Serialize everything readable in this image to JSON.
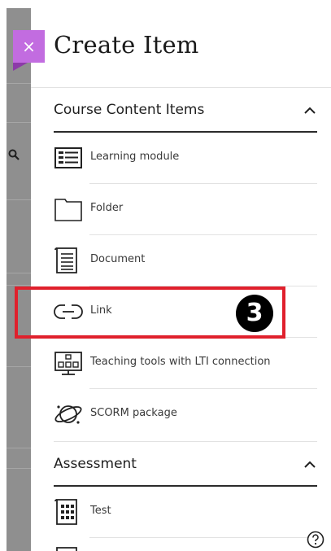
{
  "panel": {
    "title": "Create Item",
    "close_glyph": "×"
  },
  "sections": [
    {
      "label": "Course Content Items",
      "items": [
        {
          "label": "Learning module",
          "icon": "learning-module-icon"
        },
        {
          "label": "Folder",
          "icon": "folder-icon"
        },
        {
          "label": "Document",
          "icon": "document-icon"
        },
        {
          "label": "Link",
          "icon": "link-icon"
        },
        {
          "label": "Teaching tools with LTI connection",
          "icon": "lti-tools-icon"
        },
        {
          "label": "SCORM package",
          "icon": "scorm-package-icon"
        }
      ]
    },
    {
      "label": "Assessment",
      "items": [
        {
          "label": "Test",
          "icon": "test-icon"
        }
      ]
    }
  ],
  "annotation": {
    "step_number": "3",
    "color": "#e0202c"
  },
  "colors": {
    "accent": "#c26ce0",
    "highlight": "#e0202c"
  }
}
